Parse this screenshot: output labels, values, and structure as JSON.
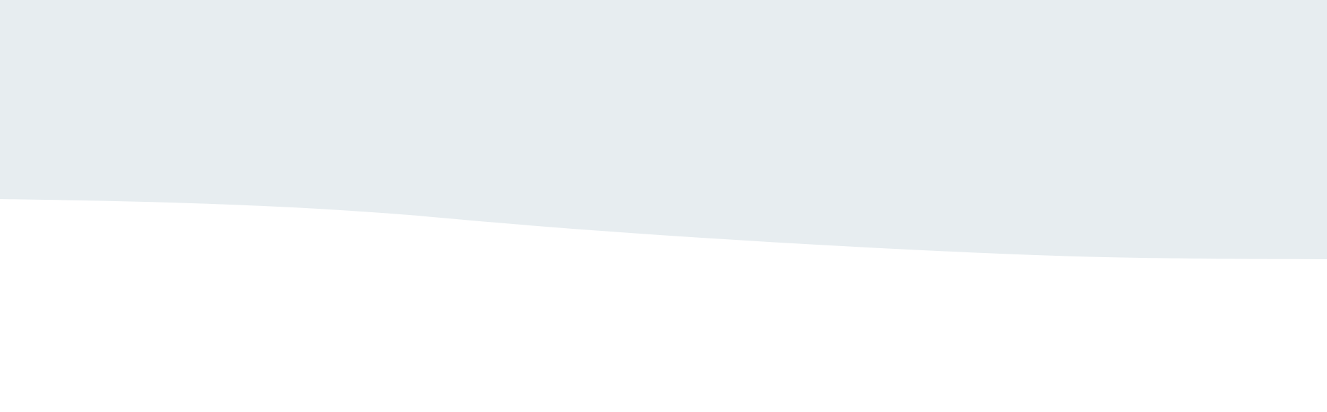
{
  "colors": {
    "page_background": "#ffffff",
    "wave_fill": "#e7edf0"
  }
}
